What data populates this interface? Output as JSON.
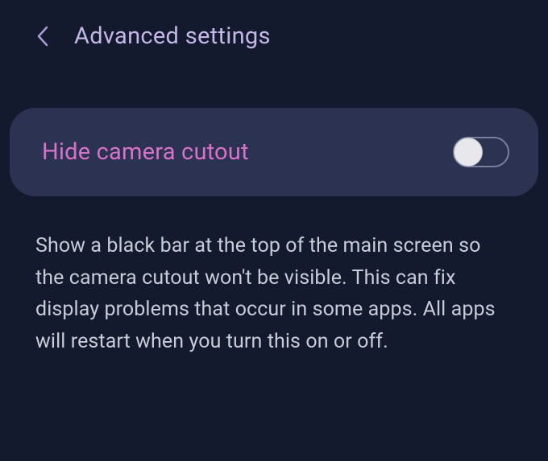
{
  "header": {
    "title": "Advanced settings"
  },
  "setting": {
    "label": "Hide camera cutout",
    "enabled": false,
    "description": "Show a black bar at the top of the main screen so the camera cutout won't be visible. This can fix display problems that occur in some apps. All apps will restart when you turn this on or off."
  }
}
